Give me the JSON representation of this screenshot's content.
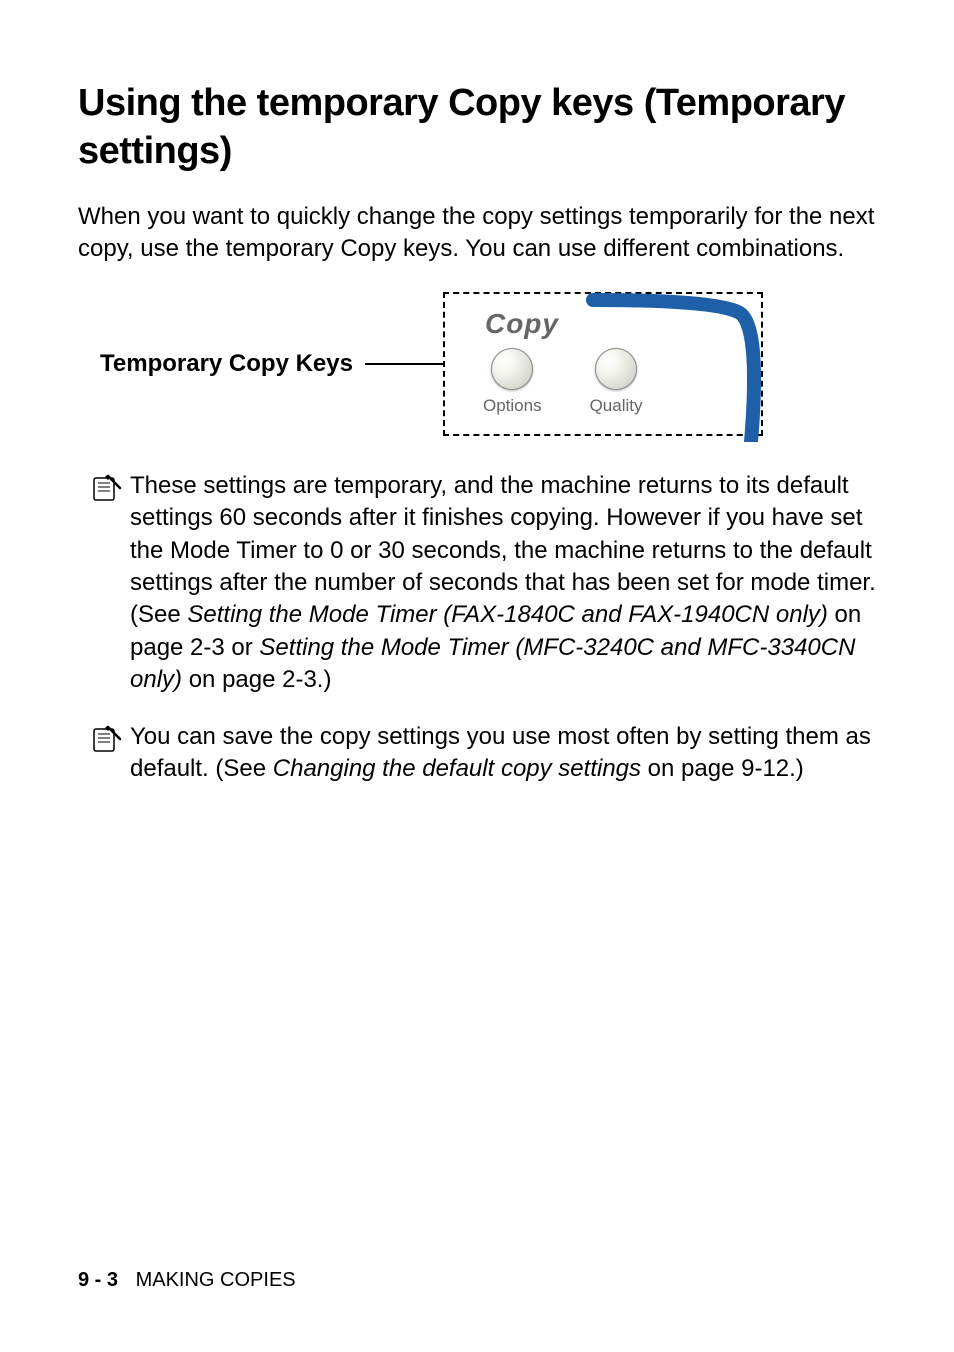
{
  "heading": "Using the temporary Copy keys (Temporary settings)",
  "intro": "When you want to quickly change the copy settings temporarily for the next copy, use the temporary Copy keys. You can use different combinations.",
  "diagram": {
    "label": "Temporary Copy Keys",
    "panel_title": "Copy",
    "button1": "Options",
    "button2": "Quality"
  },
  "note1": {
    "part1": "These settings are temporary, and the machine returns to its default settings 60 seconds after it finishes copying. However if you have set the Mode Timer to 0 or 30 seconds, the machine returns to the default settings after the number of seconds that has been set for mode timer. (See ",
    "ital1": "Setting the Mode Timer (FAX-1840C and FAX-1940CN only)",
    "part2": " on page 2-3 or ",
    "ital2": "Setting the Mode Timer (MFC-3240C and MFC-3340CN only)",
    "part3": " on page 2-3.)"
  },
  "note2": {
    "part1": "You can save the copy settings you use most often by setting them as default. (See ",
    "ital1": "Changing the default copy settings",
    "part2": " on page 9-12.)"
  },
  "footer": {
    "page": "9 - 3",
    "section": "MAKING COPIES"
  }
}
